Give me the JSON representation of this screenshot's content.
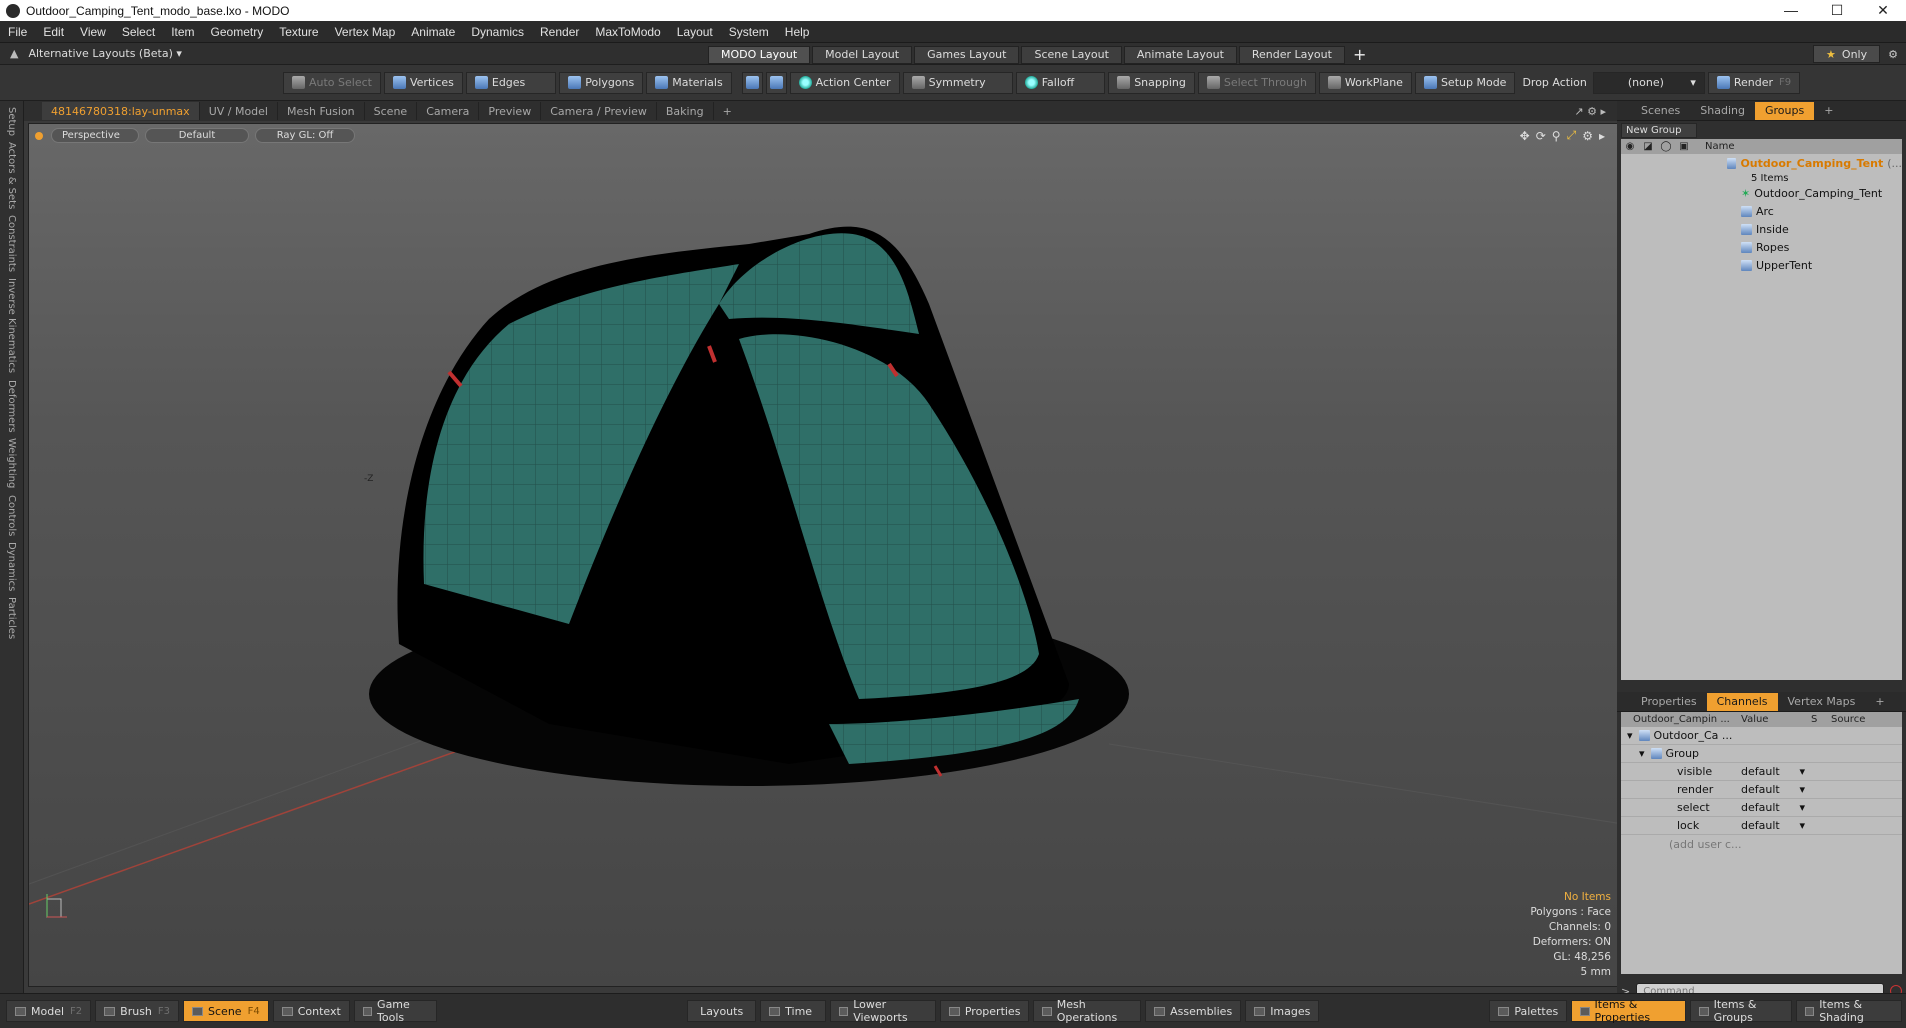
{
  "window": {
    "title": "Outdoor_Camping_Tent_modo_base.lxo - MODO"
  },
  "menu": [
    "File",
    "Edit",
    "View",
    "Select",
    "Item",
    "Geometry",
    "Texture",
    "Vertex Map",
    "Animate",
    "Dynamics",
    "Render",
    "MaxToModo",
    "Layout",
    "System",
    "Help"
  ],
  "layoutbar": {
    "alt_layouts": "Alternative Layouts (Beta)",
    "tabs": [
      "MODO Layout",
      "Model Layout",
      "Games Layout",
      "Scene Layout",
      "Animate Layout",
      "Render Layout"
    ],
    "plus": "+",
    "only": "Only"
  },
  "toolbar": {
    "auto_select": "Auto Select",
    "vertices": "Vertices",
    "edges": "Edges",
    "polygons": "Polygons",
    "materials": "Materials",
    "action_center": "Action Center",
    "symmetry": "Symmetry",
    "falloff": "Falloff",
    "snapping": "Snapping",
    "select_through": "Select Through",
    "workplane": "WorkPlane",
    "setup_mode": "Setup Mode",
    "drop_action": "Drop Action",
    "drop_value": "(none)",
    "render": "Render",
    "render_key": "F9"
  },
  "leftstrip": [
    "Setup",
    "Actors & Sets",
    "Constraints",
    "Inverse Kinematics",
    "Deformers",
    "Weighting",
    "Controls",
    "Dynamics",
    "Particles"
  ],
  "viewport_tabs": [
    "48146780318:lay-unmax",
    "UV / Model",
    "Mesh Fusion",
    "Scene",
    "Camera",
    "Preview",
    "Camera / Preview",
    "Baking",
    "+"
  ],
  "viewport": {
    "view": "Perspective",
    "shading": "Default",
    "raygl": "Ray GL: Off",
    "info": {
      "no_items": "No Items",
      "polygons": "Polygons : Face",
      "channels": "Channels: 0",
      "deformers": "Deformers: ON",
      "gl": "GL: 48,256",
      "unit": "5 mm"
    },
    "axis_z": "-Z"
  },
  "groups_panel": {
    "tabs": [
      "Scenes",
      "Shading",
      "Groups",
      "+"
    ],
    "new_group": "New Group",
    "name_header": "Name",
    "root": "Outdoor_Camping_Tent",
    "root_suffix": "(...",
    "count": "5 Items",
    "items": [
      "Outdoor_Camping_Tent",
      "Arc",
      "Inside",
      "Ropes",
      "UpperTent"
    ]
  },
  "channels_panel": {
    "tabs": [
      "Properties",
      "Channels",
      "Vertex Maps",
      "+"
    ],
    "headers": {
      "item": "Outdoor_Campin ...",
      "value": "Value",
      "s": "S",
      "source": "Source"
    },
    "root": "Outdoor_Ca ...",
    "group": "Group",
    "rows": [
      {
        "name": "visible",
        "value": "default"
      },
      {
        "name": "render",
        "value": "default"
      },
      {
        "name": "select",
        "value": "default"
      },
      {
        "name": "lock",
        "value": "default"
      }
    ],
    "add": "(add user c..."
  },
  "command": {
    "prompt": ">",
    "placeholder": "Command"
  },
  "bottombar": {
    "model": "Model",
    "model_key": "F2",
    "brush": "Brush",
    "brush_key": "F3",
    "scene": "Scene",
    "scene_key": "F4",
    "context": "Context",
    "game_tools": "Game Tools",
    "layouts": "Layouts",
    "time": "Time",
    "lower_viewports": "Lower Viewports",
    "properties": "Properties",
    "mesh_operations": "Mesh Operations",
    "assemblies": "Assemblies",
    "images": "Images",
    "palettes": "Palettes",
    "items_properties": "Items & Properties",
    "items_groups": "Items & Groups",
    "items_shading": "Items & Shading"
  },
  "colors": {
    "accent": "#f0a030",
    "tent": "#2f6f68",
    "viewport_top": "#686868",
    "viewport_bottom": "#454545"
  }
}
